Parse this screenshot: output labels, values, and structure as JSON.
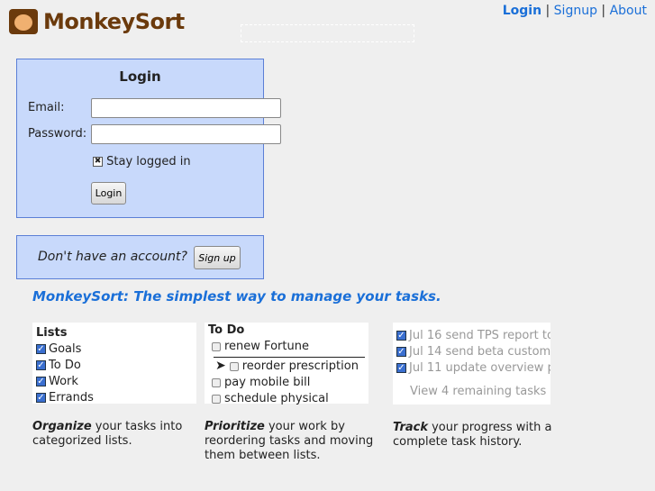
{
  "brand": {
    "name": "MonkeySort"
  },
  "topnav": {
    "login": "Login",
    "signup": "Signup",
    "about": "About",
    "sep": "|"
  },
  "login": {
    "title": "Login",
    "email_label": "Email:",
    "password_label": "Password:",
    "email_value": "",
    "password_value": "",
    "stay_label": "Stay logged in",
    "stay_checked": true,
    "button": "Login"
  },
  "signup": {
    "prompt": "Don't have an account?",
    "button": "Sign up"
  },
  "tagline": "MonkeySort: The simplest way to manage your tasks.",
  "features": {
    "lists": {
      "title": "Lists",
      "items": [
        "Goals",
        "To Do",
        "Work",
        "Errands"
      ],
      "bold": "Organize",
      "text": " your tasks into categorized lists."
    },
    "todo": {
      "title": "To Do",
      "items": [
        "renew Fortune",
        "reorder prescription",
        "pay mobile bill",
        "schedule physical"
      ],
      "bold": "Prioritize",
      "text": " your work by reordering tasks and moving them between lists."
    },
    "track": {
      "items": [
        {
          "date": "Jul 16",
          "task": "send TPS report to"
        },
        {
          "date": "Jul 14",
          "task": "send beta customer"
        },
        {
          "date": "Jul 11",
          "task": "update overview pr"
        }
      ],
      "more": "View 4 remaining tasks",
      "bold": "Track",
      "text": " your progress with a complete task history."
    }
  },
  "colors": {
    "accent": "#1a6fd8",
    "panel": "#c8d9fb",
    "brand": "#6b3a0c"
  }
}
